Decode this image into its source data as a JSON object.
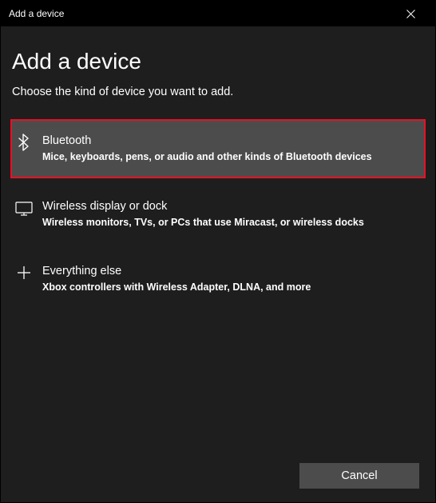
{
  "titlebar": {
    "title": "Add a device"
  },
  "main": {
    "title": "Add a device",
    "subtitle": "Choose the kind of device you want to add."
  },
  "options": [
    {
      "title": "Bluetooth",
      "desc": "Mice, keyboards, pens, or audio and other kinds of Bluetooth devices",
      "selected": true
    },
    {
      "title": "Wireless display or dock",
      "desc": "Wireless monitors, TVs, or PCs that use Miracast, or wireless docks",
      "selected": false
    },
    {
      "title": "Everything else",
      "desc": "Xbox controllers with Wireless Adapter, DLNA, and more",
      "selected": false
    }
  ],
  "footer": {
    "cancel": "Cancel"
  }
}
